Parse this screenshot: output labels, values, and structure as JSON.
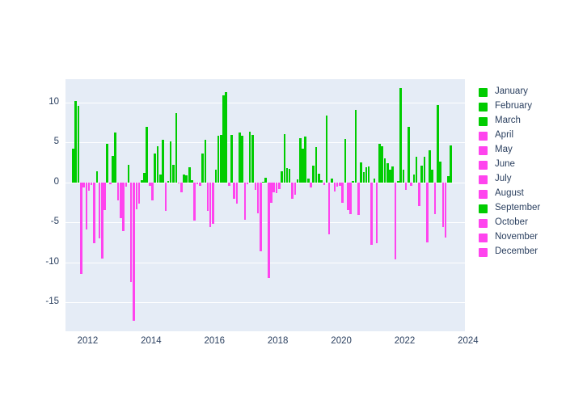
{
  "chart_data": {
    "type": "bar",
    "title": "",
    "subtitle": "",
    "xlabel": "",
    "ylabel": "",
    "xlim": [
      2011.3,
      2023.9
    ],
    "ylim": [
      -18.6,
      12.9
    ],
    "xticks": [
      "2012",
      "2014",
      "2016",
      "2018",
      "2020",
      "2022",
      "2024"
    ],
    "xtick_values": [
      2012,
      2014,
      2016,
      2018,
      2020,
      2022,
      2024
    ],
    "yticks": [
      "10",
      "5",
      "0",
      "-5",
      "-10",
      "-15"
    ],
    "ytick_values": [
      10,
      5,
      0,
      -5,
      -10,
      -15
    ],
    "grid": true,
    "grid_axis": "y",
    "legend_position": "right",
    "plot_bgcolor": "#e5ecf6",
    "paper_bgcolor": "#ffffff",
    "gridcolor": "#ffffff",
    "tick_font_color": "#2a3f5f",
    "positive_color": "#00cc00",
    "negative_color": "#ff44ee",
    "legend": [
      {
        "label": "January",
        "color": "#00cc00"
      },
      {
        "label": "February",
        "color": "#00cc00"
      },
      {
        "label": "March",
        "color": "#00cc00"
      },
      {
        "label": "April",
        "color": "#ff44ee"
      },
      {
        "label": "May",
        "color": "#ff44ee"
      },
      {
        "label": "June",
        "color": "#ff44ee"
      },
      {
        "label": "July",
        "color": "#ff44ee"
      },
      {
        "label": "August",
        "color": "#ff44ee"
      },
      {
        "label": "September",
        "color": "#00cc00"
      },
      {
        "label": "October",
        "color": "#ff44ee"
      },
      {
        "label": "November",
        "color": "#ff44ee"
      },
      {
        "label": "December",
        "color": "#ff44ee"
      }
    ],
    "x": [
      2011.54,
      2011.62,
      2011.71,
      2011.79,
      2011.87,
      2011.96,
      2012.04,
      2012.12,
      2012.21,
      2012.29,
      2012.37,
      2012.46,
      2012.54,
      2012.62,
      2012.71,
      2012.79,
      2012.87,
      2012.96,
      2013.04,
      2013.12,
      2013.21,
      2013.29,
      2013.37,
      2013.46,
      2013.54,
      2013.62,
      2013.71,
      2013.79,
      2013.87,
      2013.96,
      2014.04,
      2014.12,
      2014.21,
      2014.29,
      2014.37,
      2014.46,
      2014.54,
      2014.62,
      2014.71,
      2014.79,
      2014.87,
      2014.96,
      2015.04,
      2015.12,
      2015.21,
      2015.29,
      2015.37,
      2015.46,
      2015.54,
      2015.62,
      2015.71,
      2015.79,
      2015.87,
      2015.96,
      2016.04,
      2016.12,
      2016.21,
      2016.29,
      2016.37,
      2016.46,
      2016.54,
      2016.62,
      2016.71,
      2016.79,
      2016.87,
      2016.96,
      2017.04,
      2017.12,
      2017.21,
      2017.29,
      2017.37,
      2017.46,
      2017.54,
      2017.62,
      2017.71,
      2017.79,
      2017.87,
      2017.96,
      2018.04,
      2018.12,
      2018.21,
      2018.29,
      2018.37,
      2018.46,
      2018.54,
      2018.62,
      2018.71,
      2018.79,
      2018.87,
      2018.96,
      2019.04,
      2019.12,
      2019.21,
      2019.29,
      2019.37,
      2019.46,
      2019.54,
      2019.62,
      2019.71,
      2019.79,
      2019.87,
      2019.96,
      2020.04,
      2020.12,
      2020.21,
      2020.29,
      2020.37,
      2020.46,
      2020.54,
      2020.62,
      2020.71,
      2020.79,
      2020.87,
      2020.96,
      2021.04,
      2021.12,
      2021.21,
      2021.29,
      2021.37,
      2021.46,
      2021.54,
      2021.62,
      2021.71,
      2021.79,
      2021.87,
      2021.96,
      2022.04,
      2022.12,
      2022.21,
      2022.29,
      2022.37,
      2022.46,
      2022.54,
      2022.62,
      2022.71,
      2022.79,
      2022.87,
      2022.96,
      2023.04,
      2023.12,
      2023.21,
      2023.29,
      2023.37,
      2023.46
    ],
    "values": [
      4.2,
      10.2,
      9.6,
      -11.4,
      -0.6,
      -5.9,
      -1.0,
      -0.3,
      -7.6,
      1.4,
      -7.0,
      -9.5,
      -3.5,
      4.8,
      -0.2,
      3.3,
      6.2,
      -2.2,
      -4.5,
      -6.1,
      -0.5,
      2.2,
      -12.4,
      -17.3,
      -3.4,
      -2.6,
      0.3,
      1.2,
      6.9,
      -0.4,
      -2.2,
      3.6,
      4.5,
      1.0,
      5.3,
      -3.6,
      0.2,
      5.1,
      2.2,
      8.7,
      -0.1,
      -1.2,
      1.0,
      0.9,
      1.9,
      0.3,
      -4.8,
      -0.2,
      -0.4,
      3.6,
      5.3,
      -3.6,
      -5.6,
      -5.2,
      1.6,
      5.8,
      5.9,
      10.9,
      11.3,
      -0.4,
      5.9,
      -2.0,
      -2.6,
      6.2,
      5.8,
      -4.7,
      -0.2,
      6.3,
      5.9,
      -0.9,
      -3.9,
      -8.6,
      0.1,
      0.6,
      -11.9,
      -2.5,
      -1.2,
      -1.3,
      -0.8,
      1.4,
      6.0,
      1.8,
      1.7,
      -2.0,
      -1.5,
      0.4,
      5.5,
      4.2,
      5.7,
      0.5,
      -0.6,
      2.1,
      4.4,
      1.1,
      0.3,
      -0.3,
      8.4,
      -6.5,
      0.5,
      -1.1,
      -0.5,
      -0.4,
      -2.5,
      5.4,
      -3.5,
      -4.0,
      0.2,
      9.1,
      -4.1,
      2.5,
      1.3,
      1.9,
      2.0,
      -7.8,
      0.5,
      -7.6,
      4.8,
      4.5,
      3.0,
      2.4,
      1.6,
      2.0,
      -9.6,
      0.2,
      11.8,
      1.6,
      -0.9,
      6.9,
      -0.4,
      1.0,
      3.2,
      -3.0,
      2.1,
      3.2,
      -7.5,
      4.0,
      1.6,
      -4.0,
      9.7,
      2.6,
      -5.6,
      -6.9,
      0.8,
      4.6
    ]
  }
}
